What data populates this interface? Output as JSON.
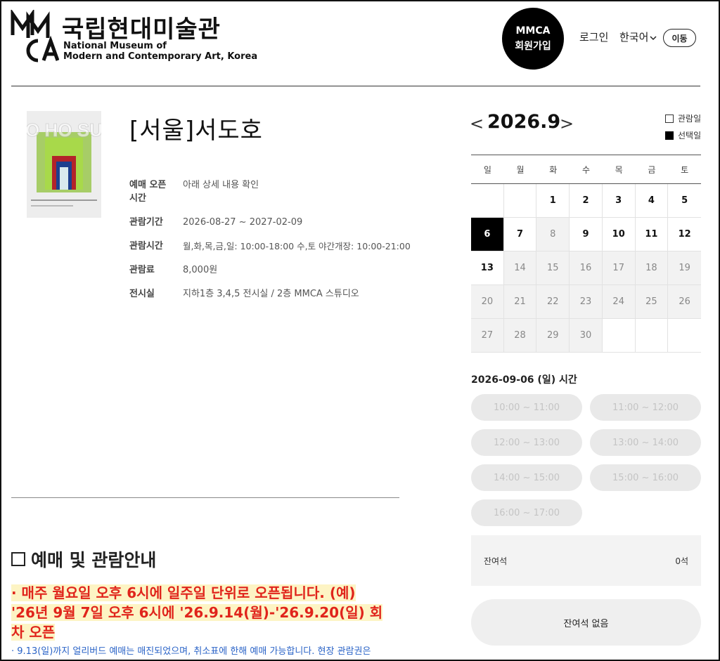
{
  "header": {
    "logo_ko": "국립현대미술관",
    "logo_en_line1": "National Museum of",
    "logo_en_line2": "Modern and Contemporary Art, Korea",
    "join_line1": "MMCA",
    "join_line2": "회원가입",
    "login": "로그인",
    "language": "한국어",
    "go": "이동"
  },
  "exhibition": {
    "title": "[서울]서도호",
    "poster_text": "DO HO SUH",
    "info": [
      {
        "label": "예매 오픈 시간",
        "value": "아래 상세 내용 확인"
      },
      {
        "label": "관람기간",
        "value": "2026-08-27 ~ 2027-02-09"
      },
      {
        "label": "관람시간",
        "value": "월,화,목,금,일: 10:00-18:00 수,토 야간개장: 10:00-21:00"
      },
      {
        "label": "관람료",
        "value": "8,000원"
      },
      {
        "label": "전시실",
        "value": "지하1층 3,4,5 전시실 / 2층 MMCA 스튜디오"
      }
    ]
  },
  "guide": {
    "title": "예매 및 관람안내",
    "notice_red": "· 매주 월요일 오후 6시에 일주일 단위로 오픈됩니다. (예) '26년 9월 7일 오후 6시에 '26.9.14(월)-'26.9.20(일) 회차 오픈",
    "notice_blue": "· 9.13(일)까지 얼리버드 예매는 매진되었으며, 취소표에 한해 예매 가능합니다. 현장 관람권은"
  },
  "calendar": {
    "prev": "<",
    "month": "2026.9",
    "next": ">",
    "legend_view": "관람일",
    "legend_selected": "선택일",
    "weekdays": [
      "일",
      "월",
      "화",
      "수",
      "목",
      "금",
      "토"
    ],
    "days": [
      {
        "d": "",
        "s": "empty"
      },
      {
        "d": "",
        "s": "empty"
      },
      {
        "d": "1",
        "s": "open"
      },
      {
        "d": "2",
        "s": "open"
      },
      {
        "d": "3",
        "s": "open"
      },
      {
        "d": "4",
        "s": "open"
      },
      {
        "d": "5",
        "s": "open"
      },
      {
        "d": "6",
        "s": "selected"
      },
      {
        "d": "7",
        "s": "open"
      },
      {
        "d": "8",
        "s": "closed"
      },
      {
        "d": "9",
        "s": "open"
      },
      {
        "d": "10",
        "s": "open"
      },
      {
        "d": "11",
        "s": "open"
      },
      {
        "d": "12",
        "s": "open"
      },
      {
        "d": "13",
        "s": "open"
      },
      {
        "d": "14",
        "s": "closed"
      },
      {
        "d": "15",
        "s": "closed"
      },
      {
        "d": "16",
        "s": "closed"
      },
      {
        "d": "17",
        "s": "closed"
      },
      {
        "d": "18",
        "s": "closed"
      },
      {
        "d": "19",
        "s": "closed"
      },
      {
        "d": "20",
        "s": "closed"
      },
      {
        "d": "21",
        "s": "closed"
      },
      {
        "d": "22",
        "s": "closed"
      },
      {
        "d": "23",
        "s": "closed"
      },
      {
        "d": "24",
        "s": "closed"
      },
      {
        "d": "25",
        "s": "closed"
      },
      {
        "d": "26",
        "s": "closed"
      },
      {
        "d": "27",
        "s": "closed"
      },
      {
        "d": "28",
        "s": "closed"
      },
      {
        "d": "29",
        "s": "closed"
      },
      {
        "d": "30",
        "s": "closed"
      },
      {
        "d": "",
        "s": "empty"
      },
      {
        "d": "",
        "s": "empty"
      },
      {
        "d": "",
        "s": "empty"
      }
    ]
  },
  "times": {
    "title": "2026-09-06 (일) 시간",
    "slots": [
      "10:00 ~ 11:00",
      "11:00 ~ 12:00",
      "12:00 ~ 13:00",
      "13:00 ~ 14:00",
      "14:00 ~ 15:00",
      "15:00 ~ 16:00",
      "16:00 ~ 17:00"
    ]
  },
  "seats": {
    "label": "잔여석",
    "count": "0석",
    "button": "잔여석 없음"
  },
  "colors": {
    "selected_day": "#000000",
    "notice_red": "#e0241b",
    "notice_highlight": "#fdf4c4",
    "notice_blue": "#2a63c7",
    "slot_disabled": "#e9e9e9"
  }
}
